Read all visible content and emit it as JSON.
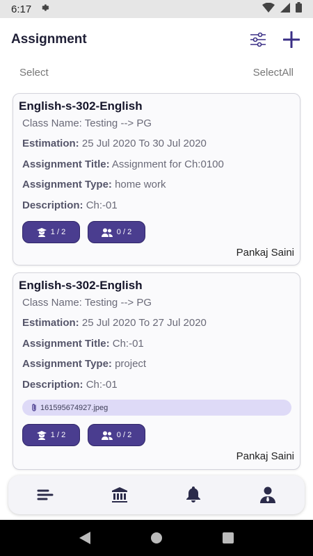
{
  "status_bar": {
    "time": "6:17"
  },
  "header": {
    "title": "Assignment"
  },
  "select_row": {
    "select_label": "Select",
    "select_all_label": "SelectAll"
  },
  "assignments": [
    {
      "subject": "English-s-302-English",
      "class_name": "Class Name: Testing --> PG",
      "estimation_label": "Estimation:",
      "estimation_value": "25 Jul 2020 To 30 Jul 2020",
      "title_label": "Assignment Title:",
      "title_value": "Assignment for Ch:0100",
      "type_label": "Assignment Type:",
      "type_value": "home work",
      "description_label": "Description:",
      "description_value": "Ch:-01",
      "submitted": "1 / 2",
      "checked": "0 / 2",
      "author": "Pankaj Saini"
    },
    {
      "subject": "English-s-302-English",
      "class_name": "Class Name: Testing --> PG",
      "estimation_label": "Estimation:",
      "estimation_value": "25 Jul 2020 To 27 Jul 2020",
      "title_label": "Assignment Title:",
      "title_value": "Ch:-01",
      "type_label": "Assignment Type:",
      "type_value": "project",
      "description_label": "Description:",
      "description_value": "Ch:-01",
      "attachment": "161595674927.jpeg",
      "submitted": "1 / 2",
      "checked": "0 / 2",
      "author": "Pankaj Saini"
    }
  ],
  "bottom_nav": {
    "items": [
      {
        "icon": "list-icon"
      },
      {
        "icon": "institution-icon"
      },
      {
        "icon": "bell-icon"
      },
      {
        "icon": "profile-icon"
      }
    ]
  },
  "colors": {
    "primary": "#3a2f86",
    "chip": "#4a3d8f",
    "attachment_bg": "#dedaf7"
  }
}
